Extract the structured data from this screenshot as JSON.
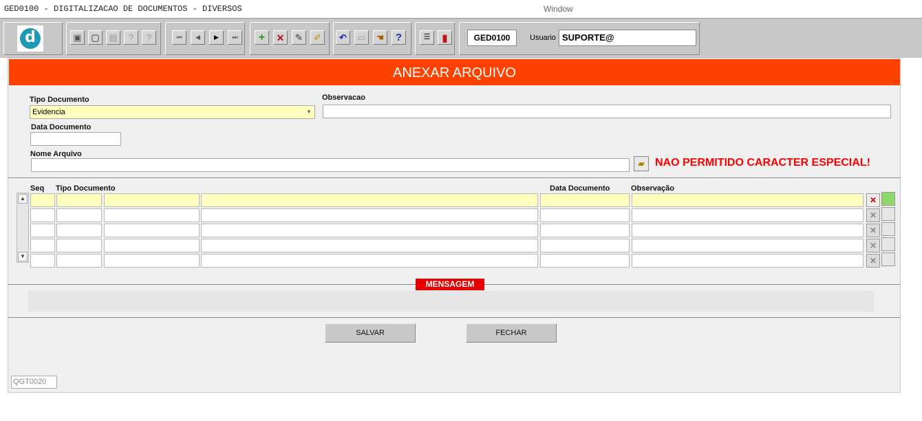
{
  "window": {
    "title": "GED0100 - DIGITALIZACAO DE DOCUMENTOS - DIVERSOS",
    "menu": "Window"
  },
  "toolbar": {
    "logo_letter": "d",
    "program_code": "GED0100",
    "usuario_label": "Usuario",
    "usuario_value": "SUPORTE@",
    "icons": [
      "save-icon",
      "screen-icon",
      "print-icon",
      "help-query-icon",
      "help-query2-icon",
      "first-record-icon",
      "previous-record-icon",
      "next-record-icon",
      "last-record-icon",
      "add-record-icon",
      "delete-record-icon",
      "edit-record-icon",
      "clear-record-icon",
      "undo-icon",
      "clipboard-icon",
      "hand-icon",
      "help-icon",
      "menu-icon",
      "exit-icon"
    ]
  },
  "form": {
    "header": "ANEXAR ARQUIVO",
    "tipo_documento_label": "Tipo Documento",
    "tipo_documento_value": "Evidencia",
    "observacao_label": "Observacao",
    "data_documento_label": "Data Documento",
    "nome_arquivo_label": "Nome Arquivo",
    "warning": "NAO PERMITIDO CARACTER ESPECIAL!"
  },
  "grid": {
    "columns": {
      "seq": "Seq",
      "tipo": "Tipo Documento",
      "data": "Data Documento",
      "obs": "Observação"
    },
    "row_count": 5
  },
  "mensagem_label": "MENSAGEM",
  "buttons": {
    "salvar": "SALVAR",
    "fechar": "FECHAR"
  },
  "form_id": "QGT0020"
}
